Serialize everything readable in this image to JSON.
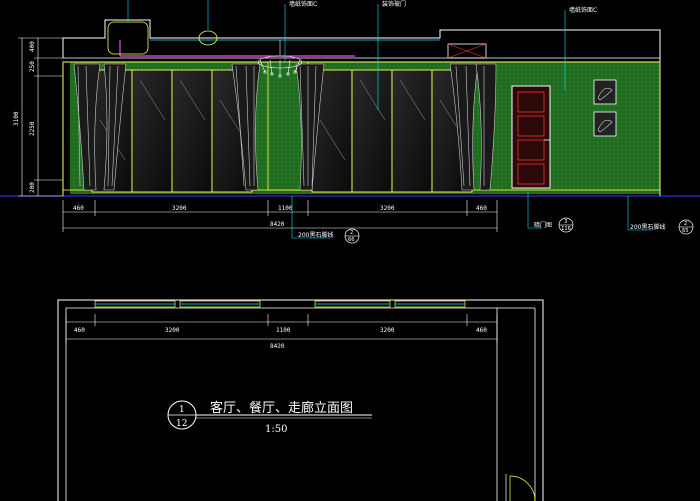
{
  "drawing": {
    "title": "客厅、餐厅、走廊立面图",
    "scale": "1:50",
    "view_number": "1",
    "sheet_number": "12"
  },
  "elevation": {
    "bottom_dims": [
      "460",
      "3200",
      "1100",
      "3200",
      "460"
    ],
    "total_dim": "8420",
    "left_dims": [
      "400",
      "250",
      "2250",
      "200"
    ],
    "left_total": "3100"
  },
  "plan": {
    "dims": [
      "460",
      "3200",
      "1100",
      "3200",
      "460"
    ],
    "total_dim": "8420"
  },
  "callouts": {
    "top_note_1": "墙纸饰面C",
    "top_note_2": "装饰玻门",
    "top_note_3": "墙纸饰面C",
    "bottom_note_1": "200黑石脚线",
    "bottom_note_1_ref_top": "2",
    "bottom_note_1_ref_bottom": "66",
    "bottom_note_2": "暗门图",
    "bottom_note_2_ref_top": "3",
    "bottom_note_2_ref_bottom": "116",
    "bottom_note_3": "200黑石脚线",
    "bottom_note_3_ref_top": "2",
    "bottom_note_3_ref_bottom": "65"
  },
  "colors": {
    "background": "#000000",
    "wall_green": "#1f6b1f",
    "line_yellow": "#ffff55",
    "line_cyan": "#00e5ff",
    "line_magenta": "#ff40ff",
    "line_white": "#ffffff",
    "line_red": "#ff3030",
    "line_blue": "#3a3aff"
  }
}
